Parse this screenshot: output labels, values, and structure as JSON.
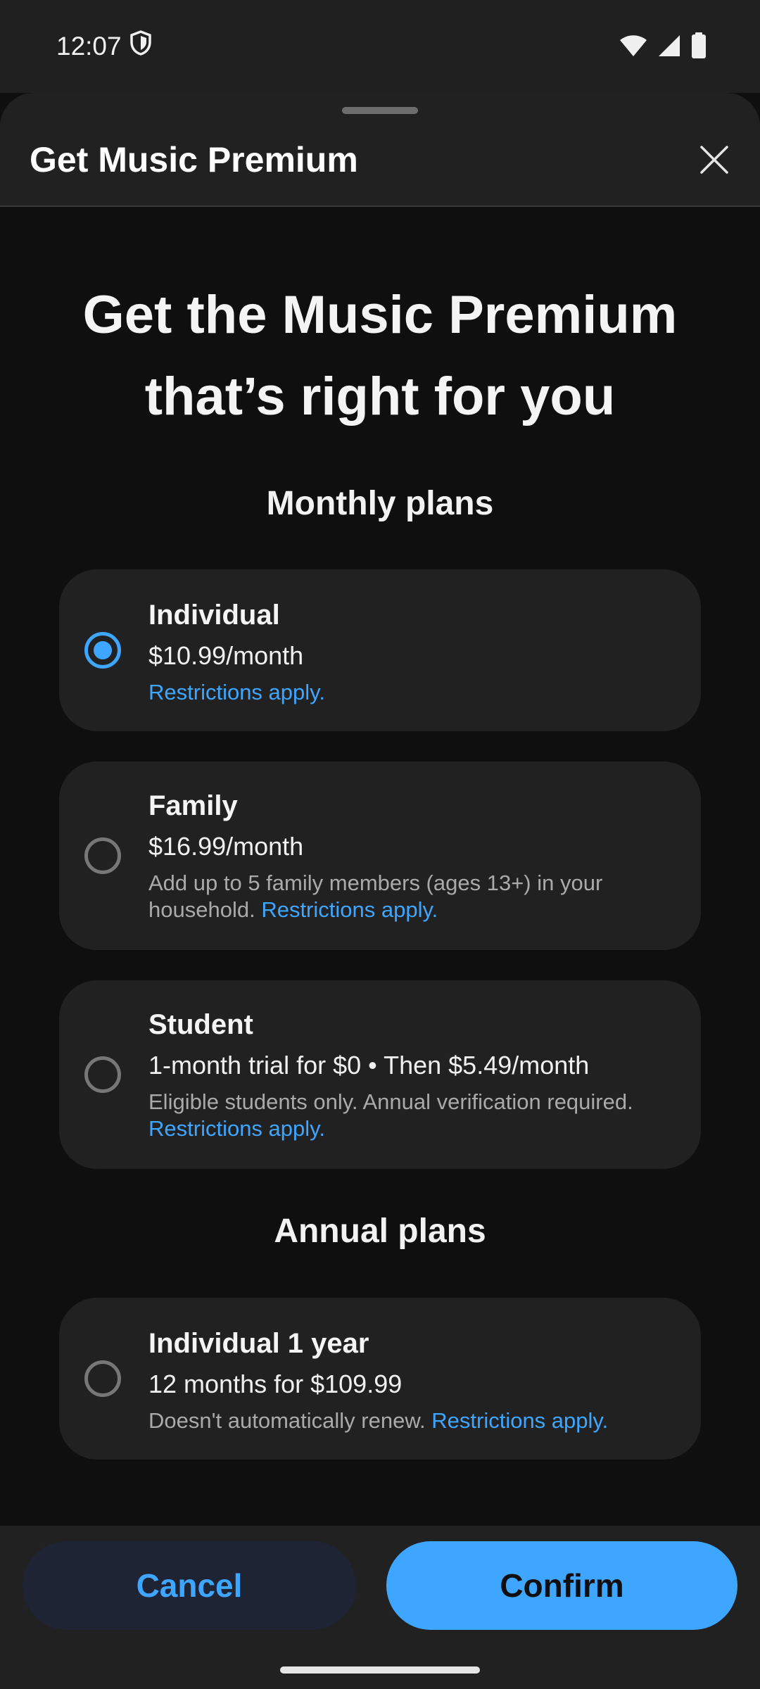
{
  "status_bar": {
    "time": "12:07",
    "icons": [
      "shield-icon",
      "wifi-icon",
      "cell-signal-icon",
      "battery-icon"
    ]
  },
  "sheet": {
    "title": "Get Music Premium",
    "close_icon": "close-icon"
  },
  "heading": {
    "line1": "Get the Music Premium",
    "line2": "that’s right for you"
  },
  "sections": {
    "monthly": "Monthly plans",
    "annual": "Annual plans"
  },
  "plans": [
    {
      "name": "Individual",
      "price": "$10.99/month",
      "description": "",
      "link": "Restrictions apply.",
      "selected": true
    },
    {
      "name": "Family",
      "price": "$16.99/month",
      "description": "Add up to 5 family members (ages 13+) in your household.",
      "link": "Restrictions apply.",
      "selected": false
    },
    {
      "name": "Student",
      "price": "1-month trial for $0 • Then $5.49/month",
      "description": "Eligible students only. Annual verification required.",
      "link": "Restrictions apply.",
      "selected": false
    },
    {
      "name": "Individual 1 year",
      "price": "12 months for $109.99",
      "description": "Doesn't automatically renew.",
      "link": "Restrictions apply.",
      "selected": false
    }
  ],
  "buttons": {
    "cancel": "Cancel",
    "confirm": "Confirm"
  },
  "colors": {
    "accent": "#3ea6ff",
    "background": "#0f0f0f",
    "card": "#212121",
    "secondary_text": "#aaaaaa"
  }
}
